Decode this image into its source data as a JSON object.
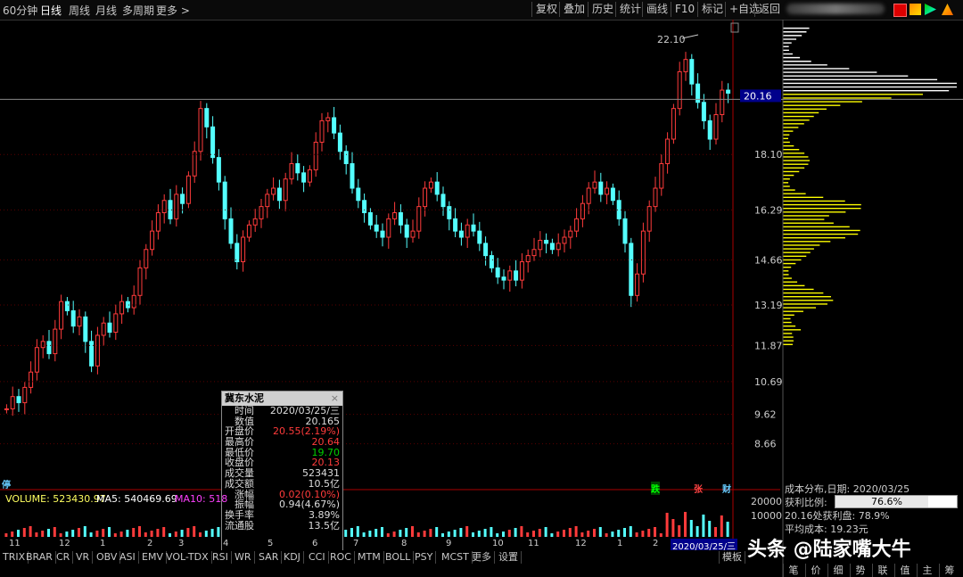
{
  "top_tabs": [
    "60分钟",
    "日线",
    "周线",
    "月线",
    "多周期",
    "更多 >"
  ],
  "active_tab": "日线",
  "right_buttons": [
    "复权",
    "叠加",
    "历史",
    "统计",
    "画线",
    "F10",
    "标记",
    "+自选",
    "返回"
  ],
  "price_axis": [
    "20.16",
    "18.10",
    "16.29",
    "14.66",
    "13.19",
    "11.87",
    "10.69",
    "9.62",
    "8.66"
  ],
  "current_price_label": "20.16",
  "peak_label": "22.10",
  "vol_axis": [
    "20000",
    "10000"
  ],
  "chart_data": {
    "type": "candlestick",
    "title": "",
    "ylim": [
      8.3,
      22.5
    ],
    "price_labels": [
      20.16,
      18.1,
      16.29,
      14.66,
      13.19,
      11.87,
      10.69,
      9.62,
      8.66
    ],
    "peak": 22.1,
    "current": 20.16
  },
  "popup": {
    "title": "冀东水泥",
    "rows": [
      {
        "label": "时间",
        "value": "2020/03/25/三"
      },
      {
        "label": "数值",
        "value": "20.165"
      },
      {
        "label": "开盘价",
        "value": "20.55(2.19%)"
      },
      {
        "label": "最高价",
        "value": "20.64"
      },
      {
        "label": "最低价",
        "value": "19.70"
      },
      {
        "label": "收盘价",
        "value": "20.13"
      },
      {
        "label": "成交量",
        "value": "523431"
      },
      {
        "label": "成交额",
        "value": "10.5亿"
      },
      {
        "label": "涨幅",
        "value": "0.02(0.10%)"
      },
      {
        "label": "振幅",
        "value": "0.94(4.67%)"
      },
      {
        "label": "换手率",
        "value": "3.89%"
      },
      {
        "label": "流通股",
        "value": "13.5亿"
      }
    ]
  },
  "volume": {
    "vol": "VOLUME: 523430.97",
    "ma5": "MA5: 540469.69",
    "ma10": "MA10: 518"
  },
  "date_ticks": [
    "11",
    "12",
    "1",
    "2",
    "3",
    "4",
    "5",
    "6",
    "7",
    "8",
    "9",
    "10",
    "11",
    "12",
    "1",
    "2"
  ],
  "date_highlight": "2020/03/25/三",
  "bottom_tabs": [
    "TRIX",
    "BRAR",
    "CR",
    "VR",
    "OBV",
    "ASI",
    "EMV",
    "VOL-TDX",
    "RSI",
    "WR",
    "SAR",
    "KDJ",
    "CCI",
    "ROC",
    "MTM",
    "BOLL",
    "PSY",
    "MCST",
    "更多",
    "设置"
  ],
  "template_btn": "模板",
  "markers": {
    "stop": "停",
    "die": "跌",
    "zhang": "张",
    "cai": "财"
  },
  "cost": {
    "title": "成本分布,日期: 2020/03/25",
    "profit_label": "获利比例:",
    "profit_value": "76.6%",
    "line2": "20.16处获利盘: 78.9%",
    "line3": "平均成本: 19.23元"
  },
  "right_tabs": [
    "笔",
    "价",
    "细",
    "势",
    "联",
    "值",
    "主",
    "筹"
  ],
  "watermark": "头条 @陆家嘴大牛"
}
